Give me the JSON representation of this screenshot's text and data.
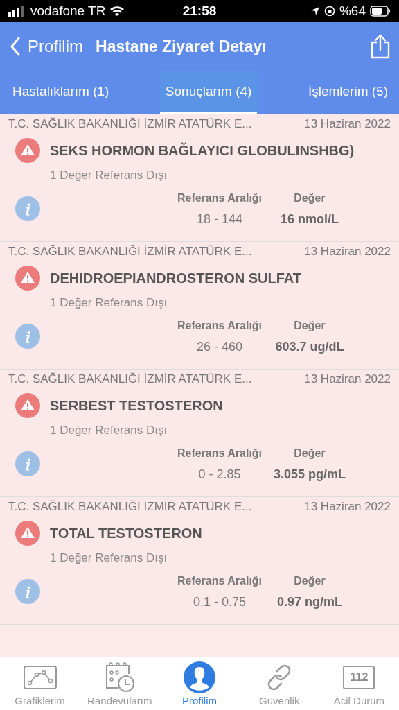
{
  "status_bar": {
    "carrier": "vodafone TR",
    "time": "21:58",
    "battery": "%64"
  },
  "nav": {
    "back": "Profilim",
    "title": "Hastane Ziyaret Detayı"
  },
  "tabs": [
    {
      "label": "Hastalıklarım (1)",
      "selected": false
    },
    {
      "label": "Sonuçlarım (4)",
      "selected": true
    },
    {
      "label": "İşlemlerim (5)",
      "selected": false
    }
  ],
  "results": [
    {
      "hospital": "T.C. SAĞLIK BAKANLIĞI İZMİR ATATÜRK E...",
      "date": "13 Haziran 2022",
      "test": "SEKS HORMON BAĞLAYICI GLOBULINSHBG)",
      "summary": "1 Değer Referans Dışı",
      "range_label": "Referans Aralığı",
      "value_label": "Değer",
      "range": "18 - 144",
      "value": "16 nmol/L",
      "out_of_range": true
    },
    {
      "hospital": "T.C. SAĞLIK BAKANLIĞI İZMİR ATATÜRK E...",
      "date": "13 Haziran 2022",
      "test": "DEHIDROEPIANDROSTERON SULFAT",
      "summary": "1 Değer Referans Dışı",
      "range_label": "Referans Aralığı",
      "value_label": "Değer",
      "range": "26 - 460",
      "value": "603.7 ug/dL",
      "out_of_range": true
    },
    {
      "hospital": "T.C. SAĞLIK BAKANLIĞI İZMİR ATATÜRK E...",
      "date": "13 Haziran 2022",
      "test": "SERBEST TESTOSTERON",
      "summary": "1 Değer Referans Dışı",
      "range_label": "Referans Aralığı",
      "value_label": "Değer",
      "range": "0 - 2.85",
      "value": "3.055 pg/mL",
      "out_of_range": true
    },
    {
      "hospital": "T.C. SAĞLIK BAKANLIĞI İZMİR ATATÜRK E...",
      "date": "13 Haziran 2022",
      "test": "TOTAL TESTOSTERON",
      "summary": "1 Değer Referans Dışı",
      "range_label": "Referans Aralığı",
      "value_label": "Değer",
      "range": "0.1 - 0.75",
      "value": "0.97 ng/mL",
      "out_of_range": true
    }
  ],
  "tab_bar": [
    {
      "kind": "chart",
      "label": "Grafiklerim",
      "selected": false
    },
    {
      "kind": "calendar",
      "label": "Randevularım",
      "selected": false
    },
    {
      "kind": "profile",
      "label": "Profilim",
      "selected": true
    },
    {
      "kind": "link",
      "label": "Güvenlik",
      "selected": false
    },
    {
      "kind": "emergency",
      "label": "Acil Durum",
      "icon_text": "112",
      "selected": false
    }
  ]
}
